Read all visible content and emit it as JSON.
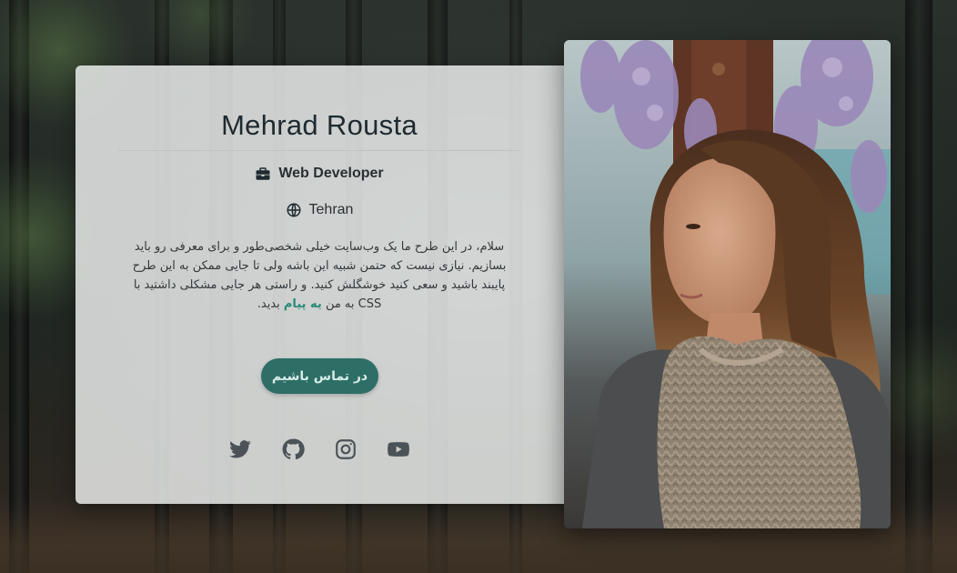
{
  "profile": {
    "name": "Mehrad Rousta",
    "role": "Web Developer",
    "location": "Tehran",
    "bio_before_link": "سلام، در این طرح ما یک وب‌سایت خیلی شخصی‌طور و برای معرفی رو باید بسازیم. نیازی نیست که حتمن شبیه این باشه ولی تا جایی ممکن به این طرح پایبند باشید و سعی کنید خوشگلش کنید. و راستی هر جایی مشکلی داشتید با CSS به من",
    "bio_link": "یه پیام",
    "bio_after_link": "بدید."
  },
  "actions": {
    "contact_label": "در تماس باشیم"
  },
  "socials": [
    {
      "name": "twitter",
      "icon": "twitter-icon"
    },
    {
      "name": "github",
      "icon": "github-icon"
    },
    {
      "name": "instagram",
      "icon": "instagram-icon"
    },
    {
      "name": "youtube",
      "icon": "youtube-icon"
    }
  ],
  "colors": {
    "accent": "#2d6e66",
    "link": "#2a8a78",
    "icon": "#4b5358"
  }
}
